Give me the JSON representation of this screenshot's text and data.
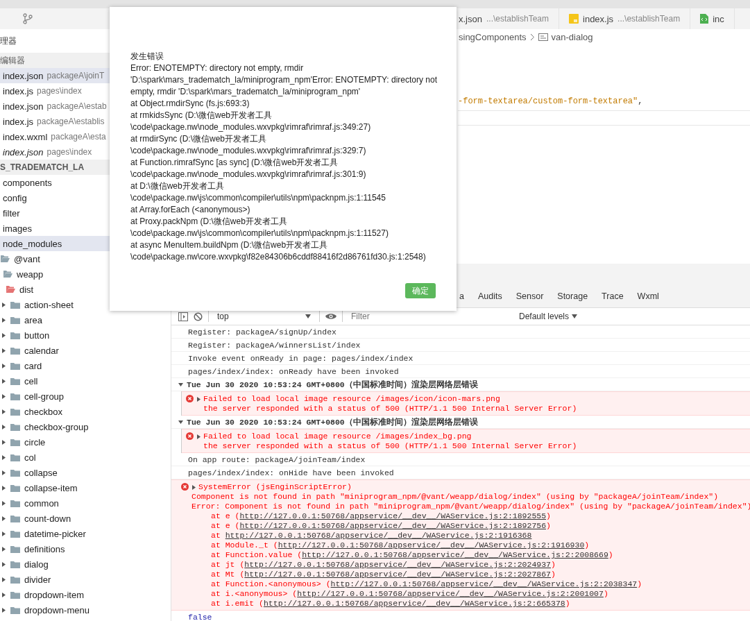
{
  "sidebar": {
    "header": "理器",
    "open_editors": {
      "title": "编辑器",
      "items": [
        {
          "name": "index.json",
          "path": "packageA\\joinT",
          "selected": true,
          "preview": false
        },
        {
          "name": "index.js",
          "path": "pages\\index",
          "selected": false,
          "preview": false
        },
        {
          "name": "index.json",
          "path": "packageA\\estab",
          "selected": false,
          "preview": false
        },
        {
          "name": "index.js",
          "path": "packageA\\establis",
          "selected": false,
          "preview": false
        },
        {
          "name": "index.wxml",
          "path": "packageA\\esta",
          "selected": false,
          "preview": false
        },
        {
          "name": "index.json",
          "path": "pages\\index",
          "selected": false,
          "preview": true
        }
      ]
    },
    "project": {
      "title": "S_TRADEMATCH_LA",
      "tree": [
        {
          "label": "components",
          "selected": false
        },
        {
          "label": "config",
          "selected": false
        },
        {
          "label": "filter",
          "selected": false
        },
        {
          "label": "images",
          "selected": false
        },
        {
          "label": "node_modules",
          "selected": true,
          "children": [
            {
              "label": "@vant",
              "selected": false,
              "expanded": true,
              "color": "#90a4ae",
              "children": [
                {
                  "label": "weapp",
                  "selected": false,
                  "expanded": true,
                  "color": "#90a4ae",
                  "children": [
                    {
                      "label": "dist",
                      "selected": false,
                      "expanded": true,
                      "color": "#e57373",
                      "children": [
                        {
                          "label": "action-sheet",
                          "selected": false,
                          "expanded": false
                        },
                        {
                          "label": "area",
                          "selected": false,
                          "expanded": false
                        },
                        {
                          "label": "button",
                          "selected": false,
                          "expanded": false
                        },
                        {
                          "label": "calendar",
                          "selected": false,
                          "expanded": false
                        },
                        {
                          "label": "card",
                          "selected": false,
                          "expanded": false
                        },
                        {
                          "label": "cell",
                          "selected": false,
                          "expanded": false
                        },
                        {
                          "label": "cell-group",
                          "selected": false,
                          "expanded": false
                        },
                        {
                          "label": "checkbox",
                          "selected": false,
                          "expanded": false
                        },
                        {
                          "label": "checkbox-group",
                          "selected": false,
                          "expanded": false
                        },
                        {
                          "label": "circle",
                          "selected": false,
                          "expanded": false
                        },
                        {
                          "label": "col",
                          "selected": false,
                          "expanded": false
                        },
                        {
                          "label": "collapse",
                          "selected": false,
                          "expanded": false
                        },
                        {
                          "label": "collapse-item",
                          "selected": false,
                          "expanded": false
                        },
                        {
                          "label": "common",
                          "selected": false,
                          "expanded": false
                        },
                        {
                          "label": "count-down",
                          "selected": false,
                          "expanded": false
                        },
                        {
                          "label": "datetime-picker",
                          "selected": false,
                          "expanded": false
                        },
                        {
                          "label": "definitions",
                          "selected": false,
                          "expanded": false
                        },
                        {
                          "label": "dialog",
                          "selected": false,
                          "expanded": false
                        },
                        {
                          "label": "divider",
                          "selected": false,
                          "expanded": false
                        },
                        {
                          "label": "dropdown-item",
                          "selected": false,
                          "expanded": false
                        },
                        {
                          "label": "dropdown-menu",
                          "selected": false,
                          "expanded": false
                        }
                      ]
                    }
                  ]
                }
              ]
            }
          ]
        }
      ]
    }
  },
  "tabs": [
    {
      "name": "x.json",
      "path": "...\\establishTeam",
      "kind": "json",
      "selected": false
    },
    {
      "name": "index.js",
      "path": "...\\establishTeam",
      "kind": "js",
      "selected": false
    },
    {
      "name": "inc",
      "kind": "wxml",
      "selected": false
    }
  ],
  "breadcrumb": [
    "singComponents",
    "van-dialog"
  ],
  "editor": {
    "string": "-form-textarea/custom-form-textarea\"",
    "punctuation": ","
  },
  "devtools": {
    "tabs": [
      {
        "label": "a",
        "selected": false
      },
      {
        "label": "Audits",
        "selected": false
      },
      {
        "label": "Sensor",
        "selected": false
      },
      {
        "label": "Storage",
        "selected": false
      },
      {
        "label": "Trace",
        "selected": false
      },
      {
        "label": "Wxml",
        "selected": false
      }
    ],
    "toolbar": {
      "context": "top",
      "filter_placeholder": "Filter",
      "levels": "Default levels"
    },
    "console": [
      {
        "kind": "log",
        "text": "Register: packageA/signUp/index"
      },
      {
        "kind": "log",
        "text": "Register: packageA/winnersList/index"
      },
      {
        "kind": "log",
        "text": "Invoke event onReady in page: pages/index/index"
      },
      {
        "kind": "log",
        "text": "pages/index/index: onReady have been invoked"
      },
      {
        "kind": "group",
        "text": "Tue Jun 30 2020 10:53:24 GMT+0800（中国标准时间）渲染层网络层错误",
        "expanded": true,
        "children": [
          {
            "kind": "error",
            "title": "Failed to load local image resource /images/icon/icon-mars.png",
            "lines": [
              "the server responded with a status of 500 (HTTP/1.1 500 Internal Server Error)"
            ]
          }
        ]
      },
      {
        "kind": "group",
        "text": "Tue Jun 30 2020 10:53:24 GMT+0800（中国标准时间）渲染层网络层错误",
        "expanded": true,
        "children": [
          {
            "kind": "error",
            "title": "Failed to load local image resource /images/index_bg.png",
            "lines": [
              "the server responded with a status of 500 (HTTP/1.1 500 Internal Server Error)"
            ]
          }
        ]
      },
      {
        "kind": "log",
        "text": "On app route: packageA/joinTeam/index"
      },
      {
        "kind": "log",
        "text": "pages/index/index: onHide have been invoked"
      },
      {
        "kind": "error",
        "title": "SystemError (jsEnginScriptError)",
        "lines": [
          "Component is not found in path \"miniprogram_npm/@vant/weapp/dialog/index\" (using by \"packageA/joinTeam/index\")",
          "Error: Component is not found in path \"miniprogram_npm/@vant/weapp/dialog/index\" (using by \"packageA/joinTeam/index\")"
        ],
        "stack": [
          {
            "prefix": "at e (",
            "url": "http://127.0.0.1:50768/appservice/__dev__/WAService.js:2:1892555",
            "suffix": ")"
          },
          {
            "prefix": "at e (",
            "url": "http://127.0.0.1:50768/appservice/__dev__/WAService.js:2:1892756",
            "suffix": ")"
          },
          {
            "prefix": "at ",
            "url": "http://127.0.0.1:50768/appservice/__dev__/WAService.js:2:1916368"
          },
          {
            "prefix": "at Module._t (",
            "url": "http://127.0.0.1:50768/appservice/__dev__/WAService.js:2:1916930",
            "suffix": ")"
          },
          {
            "prefix": "at Function.value (",
            "url": "http://127.0.0.1:50768/appservice/__dev__/WAService.js:2:2008669",
            "suffix": ")"
          },
          {
            "prefix": "at jt (",
            "url": "http://127.0.0.1:50768/appservice/__dev__/WAService.js:2:2024937",
            "suffix": ")"
          },
          {
            "prefix": "at Mt (",
            "url": "http://127.0.0.1:50768/appservice/__dev__/WAService.js:2:2027867",
            "suffix": ")"
          },
          {
            "prefix": "at Function.<anonymous> (",
            "url": "http://127.0.0.1:50768/appservice/__dev__/WAService.js:2:2038347",
            "suffix": ")"
          },
          {
            "prefix": "at i.<anonymous> (",
            "url": "http://127.0.0.1:50768/appservice/__dev__/WAService.js:2:2001007",
            "suffix": ")"
          },
          {
            "prefix": "at i.emit (",
            "url": "http://127.0.0.1:50768/appservice/__dev__/WAService.js:2:665378",
            "suffix": ")"
          }
        ]
      },
      {
        "kind": "value",
        "text": "false"
      }
    ]
  },
  "dialog": {
    "title": "发生错误",
    "lines": [
      "Error: ENOTEMPTY: directory not empty, rmdir",
      "'D:\\spark\\mars_tradematch_la/miniprogram_npm'Error: ENOTEMPTY: directory not",
      "empty, rmdir 'D:\\spark\\mars_tradematch_la/miniprogram_npm'",
      "at Object.rmdirSync (fs.js:693:3)",
      "at rmkidsSync (D:\\微信web开发者工具",
      "\\code\\package.nw\\node_modules.wxvpkg\\rimraf\\rimraf.js:349:27)",
      "at rmdirSync (D:\\微信web开发者工具",
      "\\code\\package.nw\\node_modules.wxvpkg\\rimraf\\rimraf.js:329:7)",
      "at Function.rimrafSync [as sync] (D:\\微信web开发者工具",
      "\\code\\package.nw\\node_modules.wxvpkg\\rimraf\\rimraf.js:301:9)",
      "at D:\\微信web开发者工具",
      "\\code\\package.nw\\js\\common\\compiler\\utils\\npm\\packnpm.js:1:11545",
      "at Array.forEach (<anonymous>)",
      "at Proxy.packNpm (D:\\微信web开发者工具",
      "\\code\\package.nw\\js\\common\\compiler\\utils\\npm\\packnpm.js:1:11527)",
      "at async MenuItem.buildNpm (D:\\微信web开发者工具",
      "\\code\\package.nw\\core.wxvpkg\\f82e84306b6cddf88416f2d86761fd30.js:1:2548)"
    ],
    "ok_button": "确定"
  }
}
